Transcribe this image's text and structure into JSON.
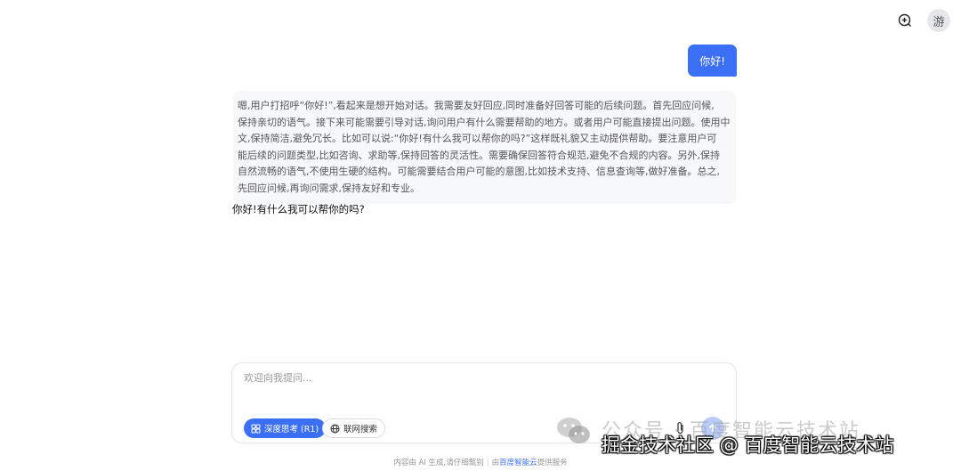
{
  "header": {
    "avatar_text": "游"
  },
  "conversation": {
    "user_message": "你好!",
    "thinking": "嗯,用户打招呼“你好!”,看起来是想开始对话。我需要友好回应,同时准备好回答可能的后续问题。首先回应问候,\n保持亲切的语气。接下来可能需要引导对话,询问用户有什么需要帮助的地方。或者用户可能直接提出问题。使用中\n文,保持简洁,避免冗长。比如可以说:“你好!有什么我可以帮你的吗?”这样既礼貌又主动提供帮助。要注意用户可\n能后续的问题类型,比如咨询、求助等,保持回答的灵活性。需要确保回答符合规范,避免不合规的内容。另外,保持\n自然流畅的语气,不使用生硬的结构。可能需要结合用户可能的意图,比如技术支持、信息查询等,做好准备。总之,\n先回应问候,再询问需求,保持友好和专业。",
    "assistant_answer": "你好!有什么我可以帮你的吗?"
  },
  "composer": {
    "placeholder": "欢迎向我提问...",
    "value": "",
    "deep_think_label": "深度思考 (R1)",
    "web_search_label": "联网搜索"
  },
  "footer": {
    "prefix": "内容由 AI 生成,请仔细甄别",
    "separator": "|",
    "by": "由",
    "brand": "百度智能云",
    "suffix": "提供服务"
  },
  "watermark": {
    "line1": "公众号 · 百度智能云技术站",
    "line2": "掘金技术社区 @ 百度智能云技术站"
  },
  "colors": {
    "accent": "#3b6ff5",
    "user_bubble": "#3b6ff5",
    "thinking_bg": "#f7f8fa"
  },
  "icons": {
    "new_chat": "new-chat-plus-icon",
    "deep_think": "deep-think-icon",
    "web_search": "globe-icon",
    "attach": "paperclip-icon",
    "send": "send-arrow-icon"
  }
}
